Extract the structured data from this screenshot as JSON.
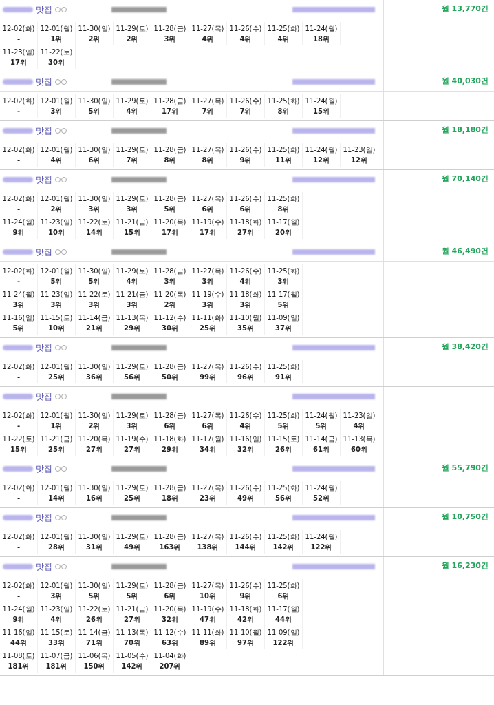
{
  "blocks": [
    {
      "keyword": "맛집",
      "monthly": "월 13,770건",
      "rows": [
        [
          [
            "12-02(화)",
            "-"
          ],
          [
            "12-01(월)",
            "1위"
          ],
          [
            "11-30(일)",
            "2위"
          ],
          [
            "11-29(토)",
            "2위"
          ],
          [
            "11-28(금)",
            "3위"
          ],
          [
            "11-27(목)",
            "4위"
          ],
          [
            "11-26(수)",
            "4위"
          ],
          [
            "11-25(화)",
            "4위"
          ],
          [
            "11-24(월)",
            "18위"
          ]
        ],
        [
          [
            "11-23(일)",
            "17위"
          ],
          [
            "11-22(토)",
            "30위"
          ]
        ]
      ]
    },
    {
      "keyword": "맛집",
      "monthly": "월 40,030건",
      "rows": [
        [
          [
            "12-02(화)",
            "-"
          ],
          [
            "12-01(월)",
            "3위"
          ],
          [
            "11-30(일)",
            "5위"
          ],
          [
            "11-29(토)",
            "4위"
          ],
          [
            "11-28(금)",
            "17위"
          ],
          [
            "11-27(목)",
            "7위"
          ],
          [
            "11-26(수)",
            "7위"
          ],
          [
            "11-25(화)",
            "8위"
          ],
          [
            "11-24(월)",
            "15위"
          ]
        ]
      ]
    },
    {
      "keyword": "맛집",
      "monthly": "월 18,180건",
      "rows": [
        [
          [
            "12-02(화)",
            "-"
          ],
          [
            "12-01(월)",
            "4위"
          ],
          [
            "11-30(일)",
            "6위"
          ],
          [
            "11-29(토)",
            "7위"
          ],
          [
            "11-28(금)",
            "8위"
          ],
          [
            "11-27(목)",
            "8위"
          ],
          [
            "11-26(수)",
            "9위"
          ],
          [
            "11-25(화)",
            "11위"
          ],
          [
            "11-24(월)",
            "12위"
          ],
          [
            "11-23(일)",
            "12위"
          ]
        ]
      ]
    },
    {
      "keyword": "맛집",
      "monthly": "월 70,140건",
      "rows": [
        [
          [
            "12-02(화)",
            "-"
          ],
          [
            "12-01(월)",
            "2위"
          ],
          [
            "11-30(일)",
            "3위"
          ],
          [
            "11-29(토)",
            "3위"
          ],
          [
            "11-28(금)",
            "5위"
          ],
          [
            "11-27(목)",
            "6위"
          ],
          [
            "11-26(수)",
            "6위"
          ],
          [
            "11-25(화)",
            "8위"
          ]
        ],
        [
          [
            "11-24(월)",
            "9위"
          ],
          [
            "11-23(일)",
            "10위"
          ],
          [
            "11-22(토)",
            "14위"
          ],
          [
            "11-21(금)",
            "15위"
          ],
          [
            "11-20(목)",
            "17위"
          ],
          [
            "11-19(수)",
            "17위"
          ],
          [
            "11-18(화)",
            "27위"
          ],
          [
            "11-17(월)",
            "20위"
          ]
        ]
      ]
    },
    {
      "keyword": "맛집",
      "monthly": "월 46,490건",
      "rows": [
        [
          [
            "12-02(화)",
            "-"
          ],
          [
            "12-01(월)",
            "5위"
          ],
          [
            "11-30(일)",
            "5위"
          ],
          [
            "11-29(토)",
            "4위"
          ],
          [
            "11-28(금)",
            "3위"
          ],
          [
            "11-27(목)",
            "3위"
          ],
          [
            "11-26(수)",
            "4위"
          ],
          [
            "11-25(화)",
            "3위"
          ]
        ],
        [
          [
            "11-24(월)",
            "3위"
          ],
          [
            "11-23(일)",
            "3위"
          ],
          [
            "11-22(토)",
            "3위"
          ],
          [
            "11-21(금)",
            "3위"
          ],
          [
            "11-20(목)",
            "2위"
          ],
          [
            "11-19(수)",
            "3위"
          ],
          [
            "11-18(화)",
            "3위"
          ],
          [
            "11-17(월)",
            "5위"
          ]
        ],
        [
          [
            "11-16(일)",
            "5위"
          ],
          [
            "11-15(토)",
            "10위"
          ],
          [
            "11-14(금)",
            "21위"
          ],
          [
            "11-13(목)",
            "29위"
          ],
          [
            "11-12(수)",
            "30위"
          ],
          [
            "11-11(화)",
            "25위"
          ],
          [
            "11-10(월)",
            "35위"
          ],
          [
            "11-09(일)",
            "37위"
          ]
        ]
      ]
    },
    {
      "keyword": "맛집",
      "monthly": "월 38,420건",
      "rows": [
        [
          [
            "12-02(화)",
            "-"
          ],
          [
            "12-01(월)",
            "25위"
          ],
          [
            "11-30(일)",
            "36위"
          ],
          [
            "11-29(토)",
            "56위"
          ],
          [
            "11-28(금)",
            "50위"
          ],
          [
            "11-27(목)",
            "99위"
          ],
          [
            "11-26(수)",
            "96위"
          ],
          [
            "11-25(화)",
            "91위"
          ]
        ]
      ]
    },
    {
      "keyword": "맛집",
      "rows": [
        [
          [
            "12-02(화)",
            "-"
          ],
          [
            "12-01(월)",
            "1위"
          ],
          [
            "11-30(일)",
            "2위"
          ],
          [
            "11-29(토)",
            "3위"
          ],
          [
            "11-28(금)",
            "6위"
          ],
          [
            "11-27(목)",
            "6위"
          ],
          [
            "11-26(수)",
            "4위"
          ],
          [
            "11-25(화)",
            "5위"
          ],
          [
            "11-24(월)",
            "5위"
          ],
          [
            "11-23(일)",
            "4위"
          ]
        ],
        [
          [
            "11-22(토)",
            "15위"
          ],
          [
            "11-21(금)",
            "25위"
          ],
          [
            "11-20(목)",
            "27위"
          ],
          [
            "11-19(수)",
            "27위"
          ],
          [
            "11-18(화)",
            "29위"
          ],
          [
            "11-17(월)",
            "34위"
          ],
          [
            "11-16(일)",
            "32위"
          ],
          [
            "11-15(토)",
            "26위"
          ],
          [
            "11-14(금)",
            "61위"
          ],
          [
            "11-13(목)",
            "60위"
          ]
        ]
      ]
    },
    {
      "keyword": "맛집",
      "monthly": "월 55,790건",
      "rows": [
        [
          [
            "12-02(화)",
            "-"
          ],
          [
            "12-01(월)",
            "14위"
          ],
          [
            "11-30(일)",
            "16위"
          ],
          [
            "11-29(토)",
            "25위"
          ],
          [
            "11-28(금)",
            "18위"
          ],
          [
            "11-27(목)",
            "23위"
          ],
          [
            "11-26(수)",
            "49위"
          ],
          [
            "11-25(화)",
            "56위"
          ],
          [
            "11-24(월)",
            "52위"
          ]
        ]
      ]
    },
    {
      "keyword": "맛집",
      "monthly": "월 10,750건",
      "rows": [
        [
          [
            "12-02(화)",
            "-"
          ],
          [
            "12-01(월)",
            "28위"
          ],
          [
            "11-30(일)",
            "31위"
          ],
          [
            "11-29(토)",
            "49위"
          ],
          [
            "11-28(금)",
            "163위"
          ],
          [
            "11-27(목)",
            "138위"
          ],
          [
            "11-26(수)",
            "144위"
          ],
          [
            "11-25(화)",
            "142위"
          ],
          [
            "11-24(월)",
            "122위"
          ]
        ]
      ]
    },
    {
      "keyword": "맛집",
      "monthly": "월 16,230건",
      "rows": [
        [
          [
            "12-02(화)",
            "-"
          ],
          [
            "12-01(월)",
            "3위"
          ],
          [
            "11-30(일)",
            "5위"
          ],
          [
            "11-29(토)",
            "5위"
          ],
          [
            "11-28(금)",
            "6위"
          ],
          [
            "11-27(목)",
            "10위"
          ],
          [
            "11-26(수)",
            "9위"
          ],
          [
            "11-25(화)",
            "6위"
          ]
        ],
        [
          [
            "11-24(월)",
            "9위"
          ],
          [
            "11-23(일)",
            "4위"
          ],
          [
            "11-22(토)",
            "26위"
          ],
          [
            "11-21(금)",
            "27위"
          ],
          [
            "11-20(목)",
            "32위"
          ],
          [
            "11-19(수)",
            "47위"
          ],
          [
            "11-18(화)",
            "42위"
          ],
          [
            "11-17(월)",
            "44위"
          ]
        ],
        [
          [
            "11-16(일)",
            "44위"
          ],
          [
            "11-15(토)",
            "33위"
          ],
          [
            "11-14(금)",
            "71위"
          ],
          [
            "11-13(목)",
            "70위"
          ],
          [
            "11-12(수)",
            "63위"
          ],
          [
            "11-11(화)",
            "89위"
          ],
          [
            "11-10(월)",
            "97위"
          ],
          [
            "11-09(일)",
            "122위"
          ]
        ],
        [
          [
            "11-08(토)",
            "181위"
          ],
          [
            "11-07(금)",
            "181위"
          ],
          [
            "11-06(목)",
            "150위"
          ],
          [
            "11-05(수)",
            "142위"
          ],
          [
            "11-04(화)",
            "207위"
          ]
        ]
      ]
    }
  ]
}
